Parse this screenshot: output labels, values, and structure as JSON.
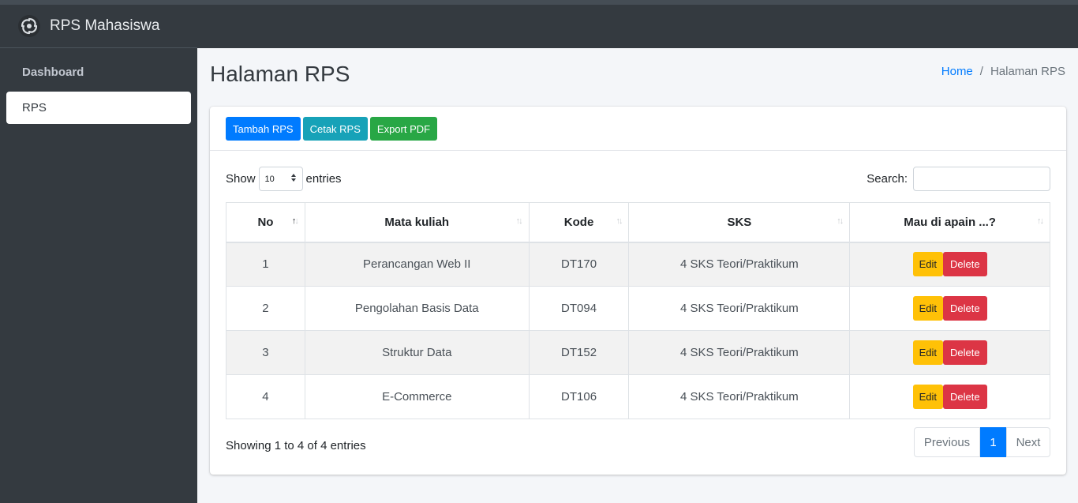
{
  "brand": {
    "title": "RPS Mahasiswa",
    "logo_icon": "spiral-logo-icon"
  },
  "sidebar": {
    "items": [
      {
        "label": "Dashboard"
      },
      {
        "label": "RPS",
        "active": true
      }
    ]
  },
  "page": {
    "title": "Halaman RPS"
  },
  "breadcrumb": {
    "home": "Home",
    "separator": "/",
    "current": "Halaman RPS"
  },
  "toolbar": {
    "add_label": "Tambah RPS",
    "print_label": "Cetak RPS",
    "export_label": "Export PDF"
  },
  "table_controls": {
    "show_label": "Show",
    "entries_value": "10",
    "entries_label": "entries",
    "search_label": "Search:",
    "search_value": ""
  },
  "table": {
    "headers": [
      "No",
      "Mata kuliah",
      "Kode",
      "SKS",
      "Mau di apain ...?"
    ],
    "rows": [
      {
        "no": "1",
        "mata_kuliah": "Perancangan Web II",
        "kode": "DT170",
        "sks": "4 SKS Teori/Praktikum"
      },
      {
        "no": "2",
        "mata_kuliah": "Pengolahan Basis Data",
        "kode": "DT094",
        "sks": "4 SKS Teori/Praktikum"
      },
      {
        "no": "3",
        "mata_kuliah": "Struktur Data",
        "kode": "DT152",
        "sks": "4 SKS Teori/Praktikum"
      },
      {
        "no": "4",
        "mata_kuliah": "E-Commerce",
        "kode": "DT106",
        "sks": "4 SKS Teori/Praktikum"
      }
    ],
    "edit_label": "Edit",
    "delete_label": "Delete"
  },
  "footer": {
    "info": "Showing 1 to 4 of 4 entries",
    "previous": "Previous",
    "current_page": "1",
    "next": "Next"
  },
  "colors": {
    "sidebar": "#343a40",
    "primary": "#007bff",
    "info": "#17a2b8",
    "success": "#28a745",
    "warning": "#ffc107",
    "danger": "#dc3545"
  }
}
